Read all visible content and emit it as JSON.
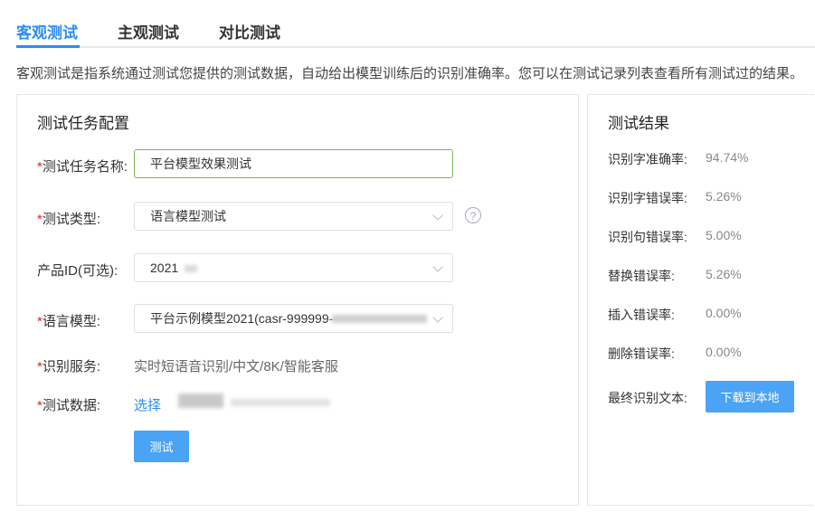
{
  "tabs": [
    {
      "label": "客观测试",
      "active": true
    },
    {
      "label": "主观测试",
      "active": false
    },
    {
      "label": "对比测试",
      "active": false
    }
  ],
  "description": "客观测试是指系统通过测试您提供的测试数据，自动给出模型训练后的识别准确率。您可以在测试记录列表查看所有测试过的结果。",
  "config": {
    "title": "测试任务配置",
    "required_mark": "*",
    "task_name": {
      "label": "测试任务名称:",
      "value": "平台模型效果测试"
    },
    "test_type": {
      "label": "测试类型:",
      "value": "语言模型测试",
      "help": "?"
    },
    "product_id": {
      "label": "产品ID(可选):",
      "value": "2021"
    },
    "language_model": {
      "label": "语言模型:",
      "value": "平台示例模型2021(casr-999999-"
    },
    "service": {
      "label": "识别服务:",
      "value": "实时短语音识别/中文/8K/智能客服"
    },
    "test_data": {
      "label": "测试数据:",
      "link": "选择"
    },
    "submit_label": "测试"
  },
  "results": {
    "title": "测试结果",
    "items": [
      {
        "label": "识别字准确率:",
        "value": "94.74%"
      },
      {
        "label": "识别字错误率:",
        "value": "5.26%"
      },
      {
        "label": "识别句错误率:",
        "value": "5.00%"
      },
      {
        "label": "替换错误率:",
        "value": "5.26%"
      },
      {
        "label": "插入错误率:",
        "value": "0.00%"
      },
      {
        "label": "删除错误率:",
        "value": "0.00%"
      }
    ],
    "final_text_label": "最终识别文本:",
    "download_label": "下载到本地"
  },
  "colors": {
    "accent": "#2d8cf0",
    "button": "#4aa3f5",
    "required": "#e02020",
    "focus_border": "#7ab653"
  }
}
